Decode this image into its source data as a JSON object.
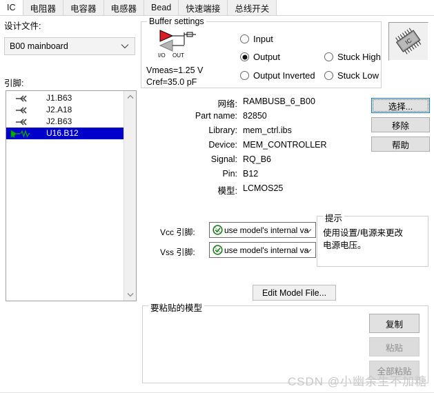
{
  "window": {
    "watermark": "CSDN @小幽余生不加糖"
  },
  "tabs": [
    {
      "label": "IC",
      "active": true
    },
    {
      "label": "电阻器",
      "active": false
    },
    {
      "label": "电容器",
      "active": false
    },
    {
      "label": "电感器",
      "active": false
    },
    {
      "label": "Bead",
      "active": false
    },
    {
      "label": "快速端接",
      "active": false
    },
    {
      "label": "总线开关",
      "active": false
    }
  ],
  "left": {
    "design_file_label": "设计文件:",
    "design_file_value": "B00 mainboard",
    "pins_label": "引脚:",
    "pins": [
      {
        "text": "J1.B63",
        "icon": "pin-input-icon",
        "selected": false
      },
      {
        "text": "J2.A18",
        "icon": "pin-input-icon",
        "selected": false
      },
      {
        "text": "J2.B63",
        "icon": "pin-input-icon",
        "selected": false
      },
      {
        "text": "U16.B12",
        "icon": "pin-driver-icon",
        "selected": true
      }
    ]
  },
  "buffer": {
    "legend": "Buffer settings",
    "symbol_label_io": "I/O",
    "symbol_label_out": "OUT",
    "vmeas": "Vmeas=1.25 V",
    "cref": "Cref=35.0 pF",
    "options": [
      {
        "label": "Input",
        "selected": false
      },
      {
        "label": "Output",
        "selected": true
      },
      {
        "label": "Output Inverted",
        "selected": false
      },
      {
        "label": "Stuck High",
        "selected": false
      },
      {
        "label": "Stuck Low",
        "selected": false
      }
    ]
  },
  "details": [
    {
      "key": "网络:",
      "value": "RAMBUSB_6_B00"
    },
    {
      "key": "Part name:",
      "value": "82850"
    },
    {
      "key": "Library:",
      "value": "mem_ctrl.ibs"
    },
    {
      "key": "Device:",
      "value": "MEM_CONTROLLER"
    },
    {
      "key": "Signal:",
      "value": "RQ_B6"
    },
    {
      "key": "Pin:",
      "value": "B12"
    },
    {
      "key": "模型:",
      "value": "LCMOS25"
    }
  ],
  "side_buttons": [
    {
      "label": "选择...",
      "focused": true,
      "disabled": false
    },
    {
      "label": "移除",
      "focused": false,
      "disabled": false
    },
    {
      "label": "帮助",
      "focused": false,
      "disabled": false
    }
  ],
  "power": {
    "vcc_label": "Vcc 引脚:",
    "vcc_value": "use model's internal va",
    "vss_label": "Vss 引脚:",
    "vss_value": "use model's internal va"
  },
  "hint": {
    "legend": "提示",
    "line1": "使用设置/电源来更改",
    "line2": "电源电压。"
  },
  "edit_model_button": "Edit Model File...",
  "paste_group": {
    "legend": "要粘贴的模型",
    "buttons": [
      {
        "label": "复制",
        "disabled": false
      },
      {
        "label": "粘贴",
        "disabled": true
      },
      {
        "label": "全部粘贴",
        "disabled": true
      }
    ]
  }
}
